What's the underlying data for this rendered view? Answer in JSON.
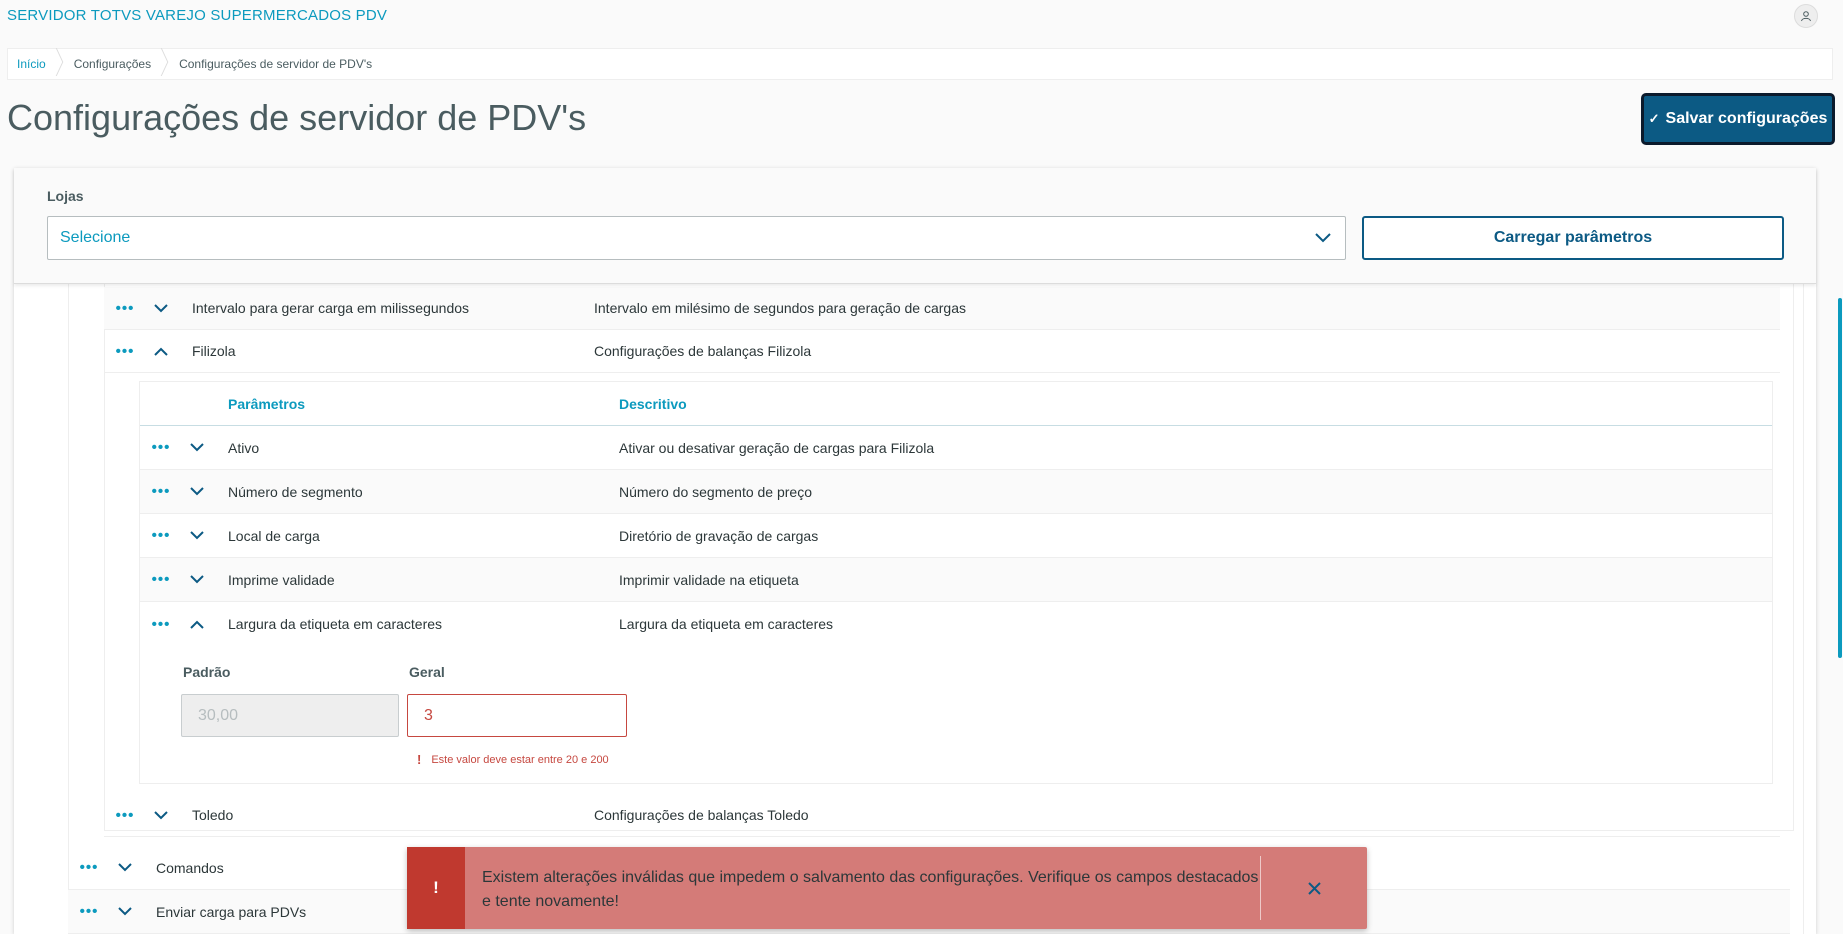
{
  "header": {
    "app_title": "SERVIDOR TOTVS VAREJO SUPERMERCADOS PDV",
    "user_icon": "user-icon"
  },
  "breadcrumb": [
    "Início",
    "Configurações",
    "Configurações de servidor de PDV's"
  ],
  "page": {
    "title": "Configurações de servidor de PDV's",
    "save_label": "Salvar configurações"
  },
  "filter": {
    "label": "Lojas",
    "select_value": "Selecione",
    "load_label": "Carregar parâmetros"
  },
  "rows_level1": [
    {
      "name": "Intervalo para gerar carga em milissegundos",
      "desc": "Intervalo em milésimo de segundos para geração de cargas"
    },
    {
      "name": "Filizola",
      "desc": "Configurações de balanças Filizola"
    }
  ],
  "params": {
    "header_name": "Parâmetros",
    "header_desc": "Descritivo",
    "rows": [
      {
        "name": "Ativo",
        "desc": "Ativar ou desativar geração de cargas para Filizola"
      },
      {
        "name": "Número de segmento",
        "desc": "Número do segmento de preço"
      },
      {
        "name": "Local de carga",
        "desc": "Diretório de gravação de cargas"
      },
      {
        "name": "Imprime validade",
        "desc": "Imprimir validade na etiqueta"
      },
      {
        "name": "Largura da etiqueta em caracteres",
        "desc": "Largura da etiqueta em caracteres"
      }
    ],
    "padrao_label": "Padrão",
    "padrao_value": "30,00",
    "geral_label": "Geral",
    "geral_value": "3",
    "error": "Este valor deve estar entre 20 e 200"
  },
  "row_toledo": {
    "name": "Toledo",
    "desc": "Configurações de balanças Toledo"
  },
  "rows_level0": [
    {
      "name": "Comandos"
    },
    {
      "name": "Enviar carga para PDVs"
    }
  ],
  "toast": {
    "message": "Existem alterações inválidas que impedem o salvamento das configurações. Verifique os campos destacados e tente novamente!",
    "icon": "!"
  },
  "colors": {
    "accent": "#0c9abe",
    "primary": "#0c5a84",
    "error": "#c64840",
    "toast_bg": "#d47b78"
  }
}
